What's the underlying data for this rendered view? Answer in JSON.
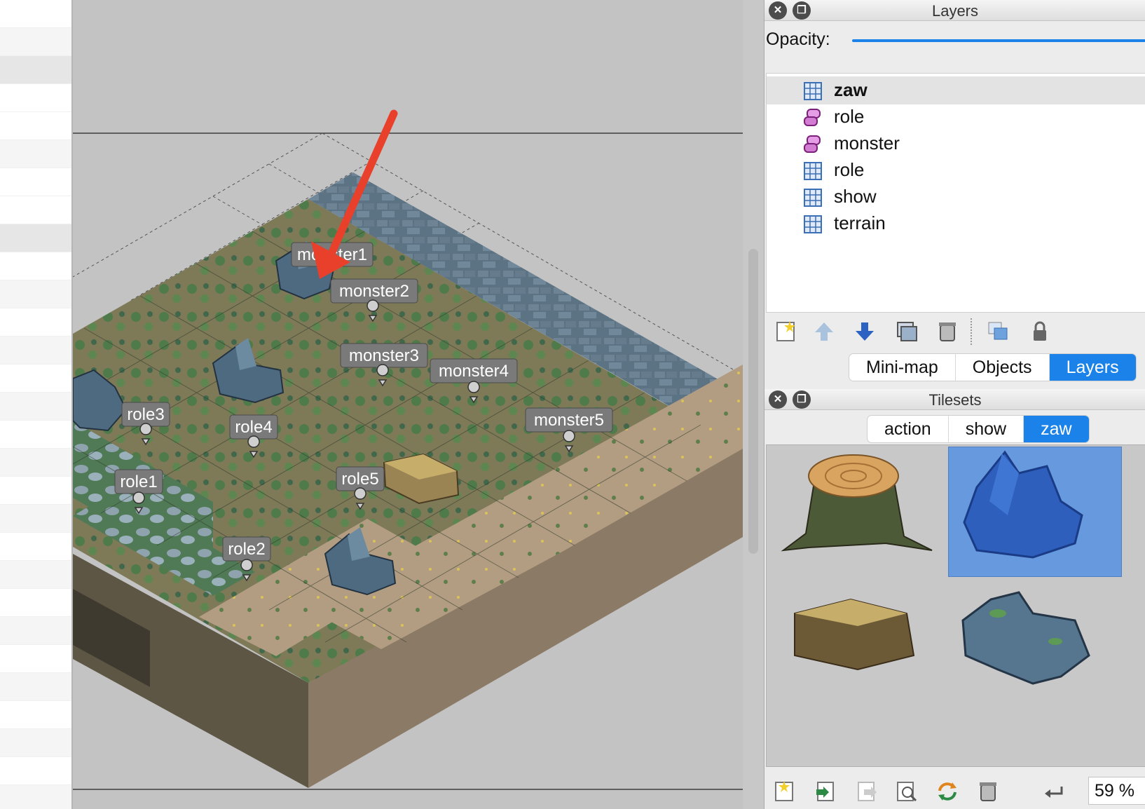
{
  "layers_panel": {
    "title": "Layers",
    "opacity_label": "Opacity:",
    "layers": [
      {
        "name": "zaw",
        "type": "tile-layer-icon",
        "selected": true
      },
      {
        "name": "role",
        "type": "object-layer-icon",
        "selected": false
      },
      {
        "name": "monster",
        "type": "object-layer-icon",
        "selected": false
      },
      {
        "name": "role",
        "type": "tile-layer-icon",
        "selected": false
      },
      {
        "name": "show",
        "type": "tile-layer-icon",
        "selected": false
      },
      {
        "name": "terrain",
        "type": "tile-layer-icon",
        "selected": false
      }
    ],
    "tabs": [
      "Mini-map",
      "Objects",
      "Layers"
    ],
    "active_tab": "Layers"
  },
  "tilesets_panel": {
    "title": "Tilesets",
    "tabs": [
      "action",
      "show",
      "zaw"
    ],
    "active_tab": "zaw",
    "tiles": [
      "tree-stump-icon",
      "blue-rock-icon",
      "broken-log-icon",
      "mossy-rock-icon"
    ],
    "selected_tile": "blue-rock-icon",
    "zoom": "59 %"
  },
  "map_objects": [
    {
      "name": "monster1"
    },
    {
      "name": "monster2"
    },
    {
      "name": "monster3"
    },
    {
      "name": "monster4"
    },
    {
      "name": "monster5"
    },
    {
      "name": "role1"
    },
    {
      "name": "role2"
    },
    {
      "name": "role3"
    },
    {
      "name": "role4"
    },
    {
      "name": "role5"
    }
  ],
  "colors": {
    "accent": "#1a82e8",
    "annotation_arrow": "#e8402a",
    "label_bg": "#7a7a7a"
  }
}
